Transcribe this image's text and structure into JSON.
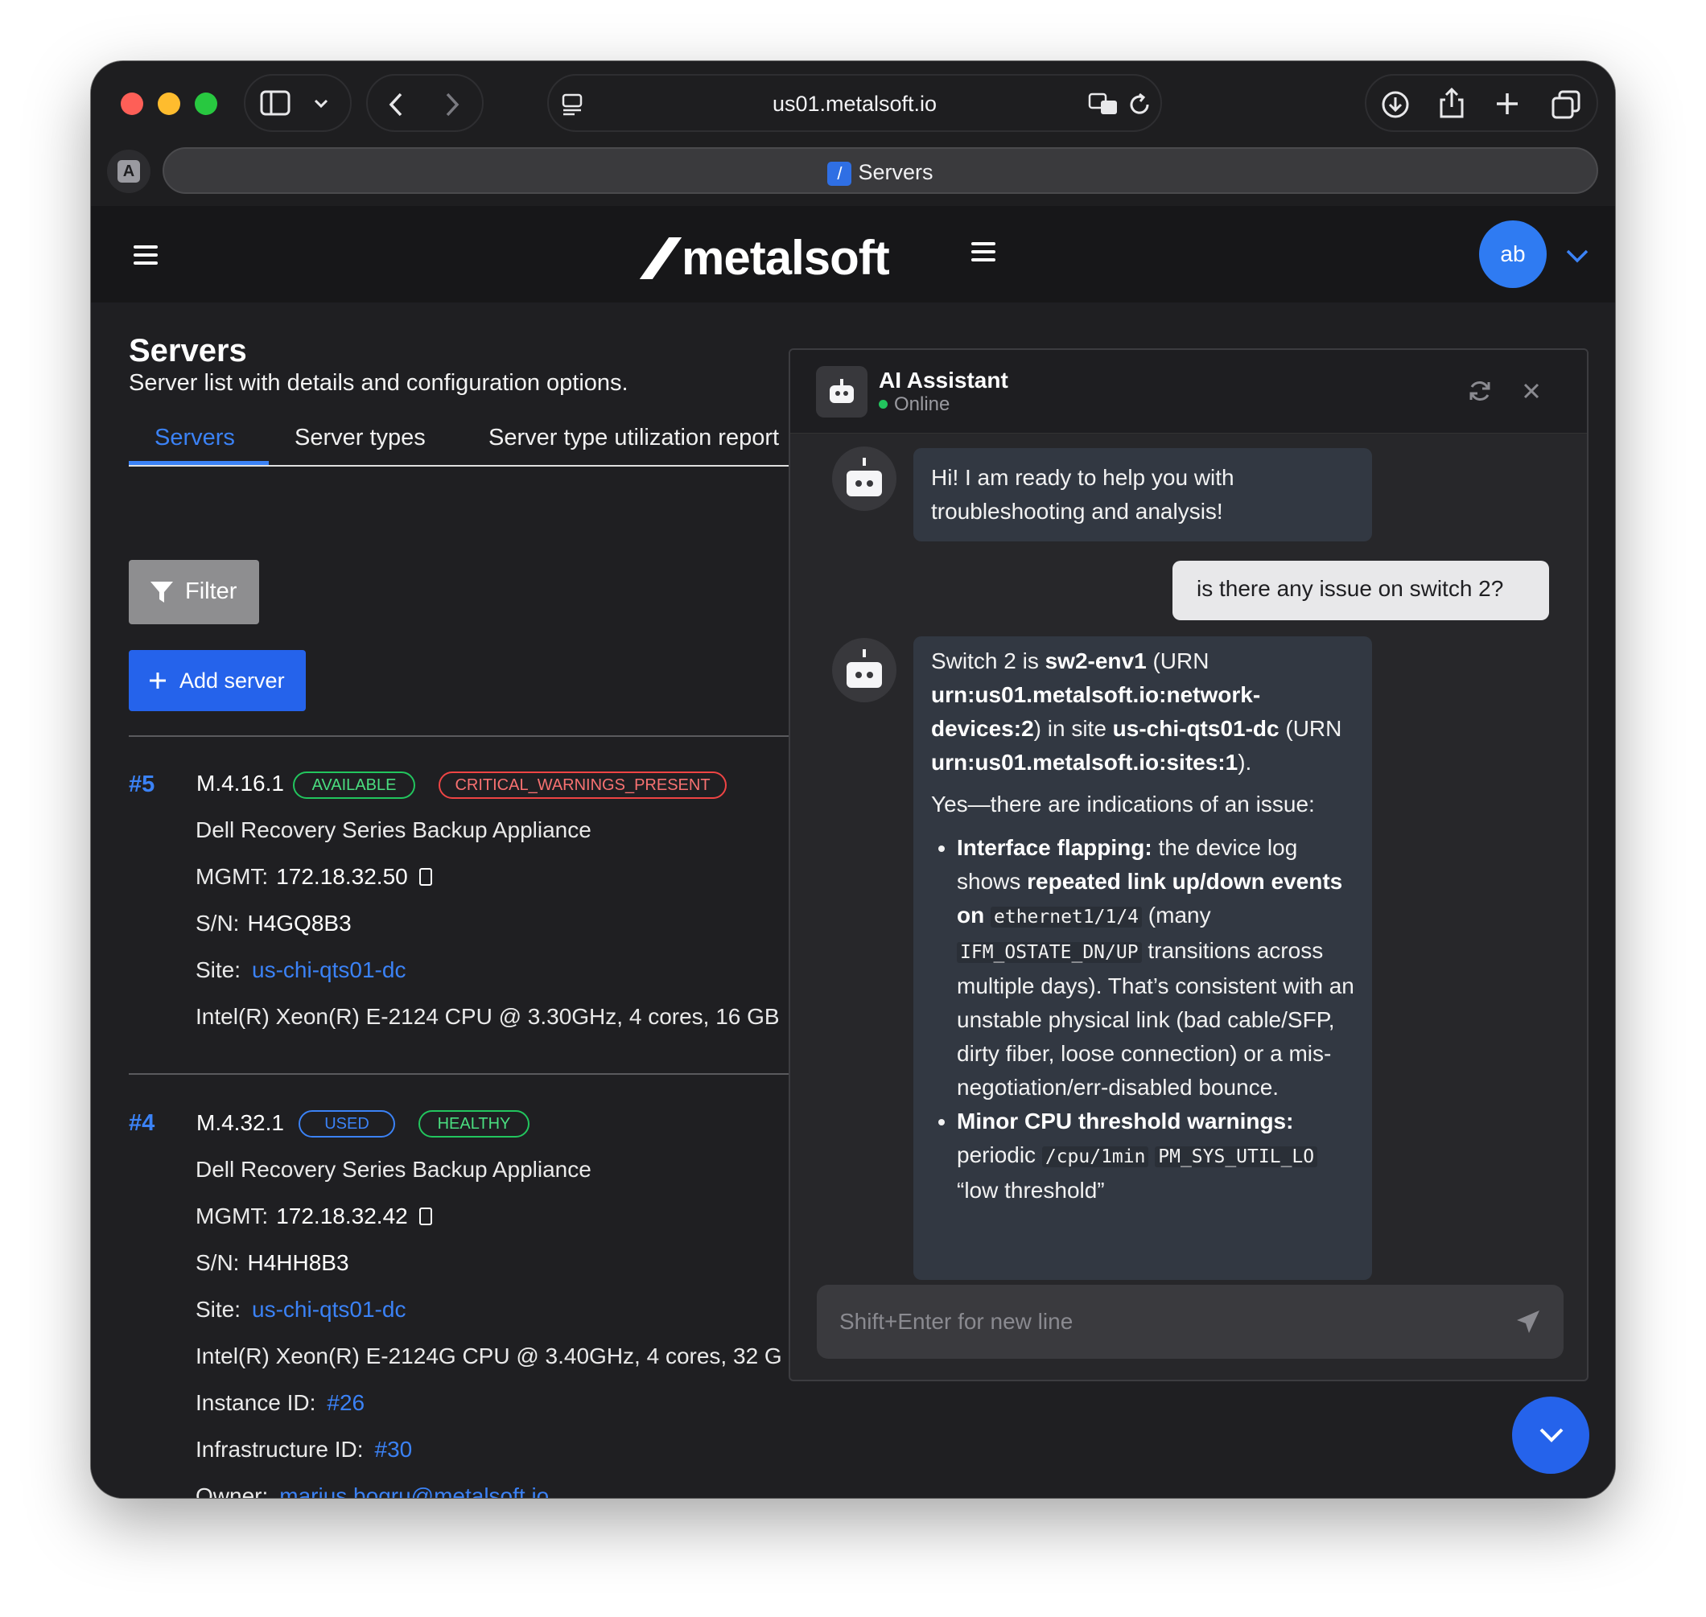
{
  "browser": {
    "url": "us01.metalsoft.io",
    "tab_title": "Servers",
    "profile_letter": "A"
  },
  "app": {
    "logo": "metalsoft",
    "user_initials": "ab"
  },
  "page": {
    "title": "Servers",
    "subtitle": "Server list with details and configuration options.",
    "tabs": [
      "Servers",
      "Server types",
      "Server type utilization report"
    ],
    "filter_label": "Filter",
    "add_label": "Add server"
  },
  "servers": [
    {
      "id": "#5",
      "model": "M.4.16.1",
      "badges": [
        "AVAILABLE",
        "CRITICAL_WARNINGS_PRESENT"
      ],
      "description": "Dell Recovery Series Backup Appliance",
      "mgmt_label": "MGMT:",
      "mgmt": "172.18.32.50",
      "sn_label": "S/N:",
      "sn": "H4GQ8B3",
      "site_label": "Site:",
      "site": "us-chi-qts01-dc",
      "cpu": "Intel(R) Xeon(R) E-2124 CPU @ 3.30GHz, 4 cores, 16 GB"
    },
    {
      "id": "#4",
      "model": "M.4.32.1",
      "badges": [
        "USED",
        "HEALTHY"
      ],
      "description": "Dell Recovery Series Backup Appliance",
      "mgmt_label": "MGMT:",
      "mgmt": "172.18.32.42",
      "sn_label": "S/N:",
      "sn": "H4HH8B3",
      "site_label": "Site:",
      "site": "us-chi-qts01-dc",
      "cpu": "Intel(R) Xeon(R) E-2124G CPU @ 3.40GHz, 4 cores, 32 G",
      "instance_label": "Instance ID:",
      "instance": "#26",
      "infra_label": "Infrastructure ID:",
      "infra": "#30",
      "owner_label": "Owner:",
      "owner": "marius.bogru@metalsoft.io"
    }
  ],
  "assistant": {
    "title": "AI Assistant",
    "status": "Online",
    "greeting": "Hi! I am ready to help you with troubleshooting and analysis!",
    "user_message": "is there any issue on switch 2?",
    "reply": {
      "p1_a": "Switch 2 is ",
      "p1_b": "sw2-env1",
      "p1_c": " (URN ",
      "p1_d": "urn:us01.metalsoft.io:network-devices:2",
      "p1_e": ") in site ",
      "p1_f": "us-chi-qts01-dc",
      "p1_g": " (URN ",
      "p1_h": "urn:us01.metalsoft.io:sites:1",
      "p1_i": ").",
      "p2": "Yes—there are indications of an issue:",
      "b1_title": "Interface flapping:",
      "b1_a": " the device log shows ",
      "b1_b": "repeated link up/down events on ",
      "b1_code1": "ethernet1/1/4",
      "b1_c": " (many ",
      "b1_code2": "IFM_OSTATE_DN/UP",
      "b1_d": " transitions across multiple days). That’s consistent with an unstable physical link (bad cable/SFP, dirty fiber, loose connection) or a mis-negotiation/err-disabled bounce.",
      "b2_title": "Minor CPU threshold warnings:",
      "b2_a": " periodic ",
      "b2_code1": "/cpu/1min",
      "b2_code2": "PM_SYS_UTIL_LO",
      "b2_b": " “low threshold”"
    },
    "input_placeholder": "Shift+Enter for new line"
  }
}
